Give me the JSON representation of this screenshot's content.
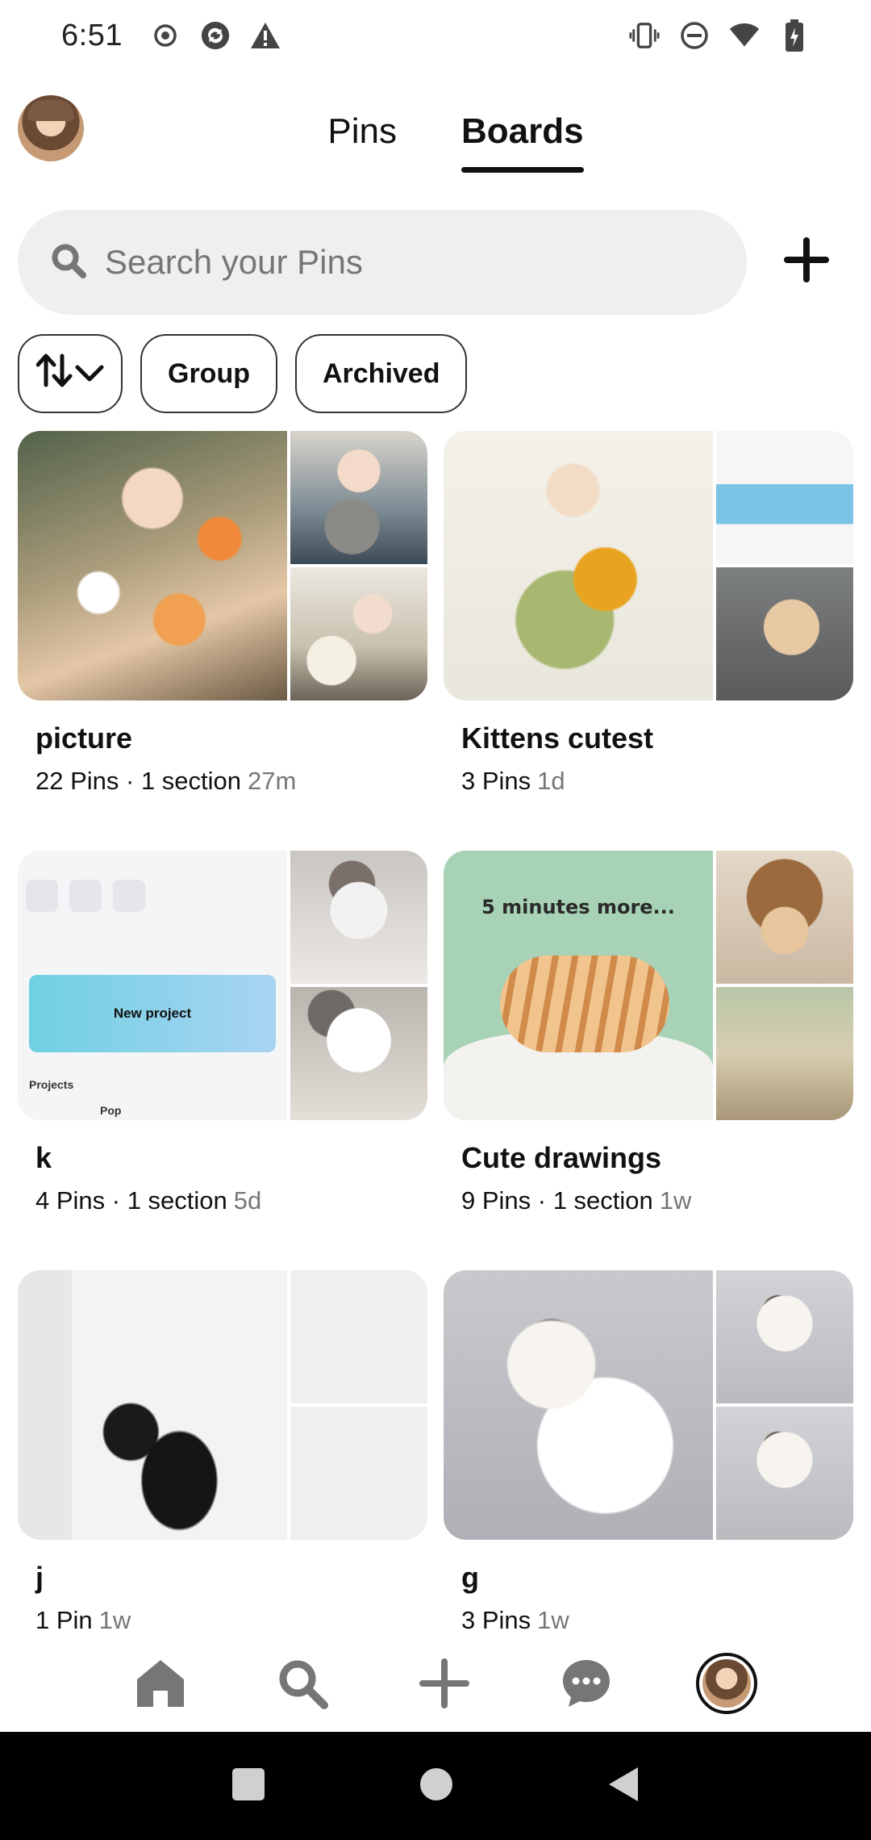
{
  "status_bar": {
    "time": "6:51",
    "left_icons": [
      "record-icon",
      "sync-icon",
      "warning-icon"
    ],
    "right_icons": [
      "vibrate-icon",
      "do-not-disturb-icon",
      "wifi-icon",
      "battery-charging-icon"
    ]
  },
  "header": {
    "tabs": [
      {
        "label": "Pins",
        "active": false
      },
      {
        "label": "Boards",
        "active": true
      }
    ]
  },
  "search": {
    "placeholder": "Search your Pins",
    "add_icon": "plus-icon"
  },
  "filters": {
    "sort_icon": "sort-arrows-icon",
    "chips": [
      "Group",
      "Archived"
    ]
  },
  "boards": [
    {
      "title": "picture",
      "meta": "22 Pins · 1 section",
      "time": "27m"
    },
    {
      "title": "Kittens cutest",
      "meta": "3 Pins",
      "time": "1d"
    },
    {
      "title": "k",
      "meta": "4 Pins · 1 section",
      "time": "5d"
    },
    {
      "title": "Cute drawings",
      "meta": "9 Pins · 1 section",
      "time": "1w"
    },
    {
      "title": "j",
      "meta": "1 Pin",
      "time": "1w"
    },
    {
      "title": "g",
      "meta": "3 Pins",
      "time": "1w"
    }
  ],
  "board_images": {
    "k_ui": {
      "new_project": "New project",
      "projects": "Projects",
      "pop": "Pop"
    },
    "drawing_text": "5 minutes more..."
  },
  "bottom_nav": [
    "home-icon",
    "search-icon",
    "plus-icon",
    "chat-icon",
    "profile-avatar"
  ],
  "colors": {
    "text": "#111111",
    "muted": "#767676",
    "search_bg": "#efefef"
  }
}
